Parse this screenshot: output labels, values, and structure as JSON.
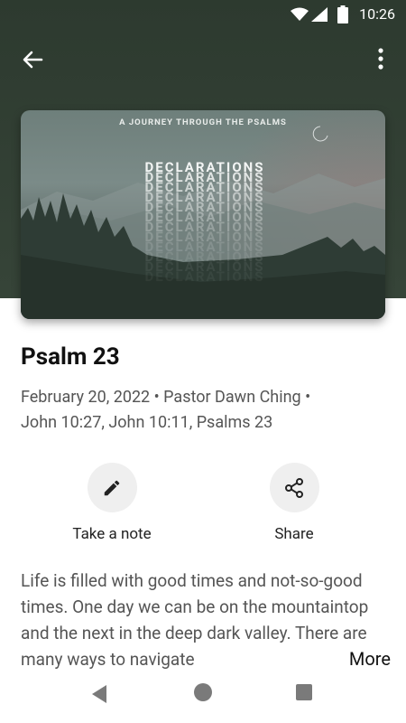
{
  "status_bar": {
    "time": "10:26"
  },
  "artwork": {
    "subtitle": "A JOURNEY THROUGH THE PSALMS",
    "title": "DECLARATIONS"
  },
  "sermon": {
    "title": "Psalm 23",
    "meta_line1": "February 20, 2022 • Pastor Dawn Ching •",
    "meta_line2": "John 10:27, John 10:11, Psalms 23"
  },
  "actions": {
    "note_label": "Take a note",
    "share_label": "Share"
  },
  "description": {
    "text": "Life is filled with good times and not-so-good times. One day we can be on the mountaintop and the next in the deep dark valley. There are many ways to navigate",
    "more_label": "More"
  },
  "colors": {
    "header": "#2d3a2f",
    "action_bg": "#efefef"
  }
}
